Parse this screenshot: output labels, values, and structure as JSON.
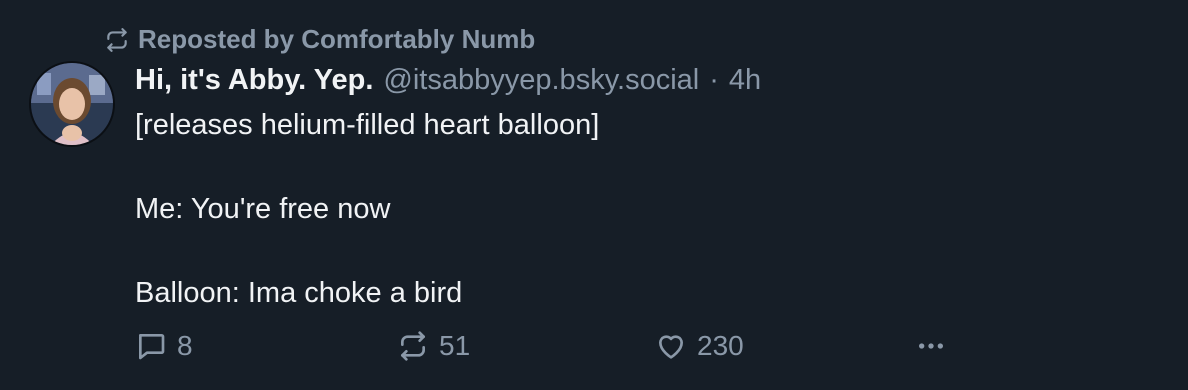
{
  "repost": {
    "text": "Reposted by Comfortably Numb",
    "icon": "repost-icon"
  },
  "author": {
    "display_name": "Hi, it's Abby. Yep.",
    "handle": "@itsabbyyep.bsky.social",
    "separator": "·",
    "time": "4h"
  },
  "post": {
    "lines": [
      "[releases helium-filled heart balloon]",
      "Me: You're free now",
      "Balloon: Ima choke a bird"
    ]
  },
  "actions": {
    "replies": "8",
    "reposts": "51",
    "likes": "230",
    "more_icon": "more-horizontal-icon"
  },
  "colors": {
    "background": "#161e27",
    "text": "#f1f3f5",
    "muted": "#8a98a8"
  }
}
